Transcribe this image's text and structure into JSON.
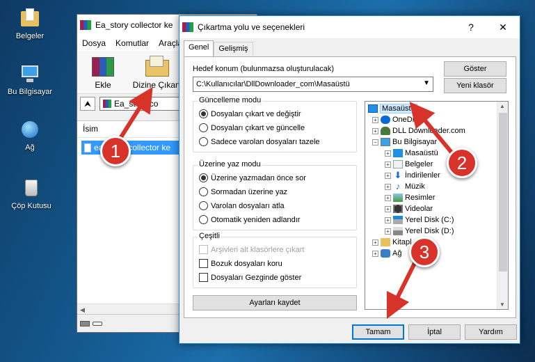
{
  "desktop": {
    "icons": [
      {
        "label": "Belgeler",
        "icon": "folder-documents-icon"
      },
      {
        "label": "Bu Bilgisayar",
        "icon": "computer-icon"
      },
      {
        "label": "Ağ",
        "icon": "network-icon"
      },
      {
        "label": "Çöp Kutusu",
        "icon": "recycle-bin-icon"
      }
    ]
  },
  "winrar": {
    "title": "Ea_story collector ke",
    "menu": [
      "Dosya",
      "Komutlar",
      "Araçla"
    ],
    "toolbar": {
      "add": "Ekle",
      "extract": "Dizine Çıkart"
    },
    "address": "Ea_story co",
    "list_header": "İsim",
    "list_item": "ea_story collector ke"
  },
  "dialog": {
    "title": "Çıkartma yolu ve seçenekleri",
    "help_btn": "?",
    "close_btn": "✕",
    "tabs": [
      "Genel",
      "Gelişmiş"
    ],
    "dest_label": "Hedef konum (bulunmazsa oluşturulacak)",
    "dest_value": "C:\\Kullanıcılar\\DllDownloader_com\\Masaüstü",
    "show_btn": "Göster",
    "new_folder_btn": "Yeni klasör",
    "update_group": {
      "title": "Güncelleme modu",
      "options": [
        "Dosyaları çıkart ve değiştir",
        "Dosyaları çıkart ve güncelle",
        "Sadece varolan dosyaları tazele"
      ],
      "selected": 0
    },
    "overwrite_group": {
      "title": "Üzerine yaz modu",
      "options": [
        "Üzerine yazmadan önce sor",
        "Sormadan üzerine yaz",
        "Varolan dosyaları atla",
        "Otomatik yeniden adlandır"
      ],
      "selected": 0
    },
    "misc_group": {
      "title": "Çeşitli",
      "options": [
        "Arşivleri alt klasörlere çıkart",
        "Bozuk dosyaları koru",
        "Dosyaları Gezginde göster"
      ]
    },
    "save_btn": "Ayarları kaydet",
    "tree": [
      {
        "label": "Masaüstü",
        "icon": "desktop-icon"
      },
      {
        "label": "OneDr",
        "icon": "onedrive-icon"
      },
      {
        "label": "DLL Downloader.com",
        "icon": "user-icon"
      },
      {
        "label": "Bu Bilgisayar",
        "icon": "computer-icon"
      },
      {
        "label": "Masaüstü",
        "icon": "desktop-icon"
      },
      {
        "label": "Belgeler",
        "icon": "documents-icon"
      },
      {
        "label": "İndirilenler",
        "icon": "download-icon"
      },
      {
        "label": "Müzik",
        "icon": "music-icon"
      },
      {
        "label": "Resimler",
        "icon": "pictures-icon"
      },
      {
        "label": "Videolar",
        "icon": "videos-icon"
      },
      {
        "label": "Yerel Disk (C:)",
        "icon": "drive-icon"
      },
      {
        "label": "Yerel Disk (D:)",
        "icon": "drive-icon"
      },
      {
        "label": "Kitapl",
        "icon": "library-icon"
      },
      {
        "label": "Ağ",
        "icon": "network-icon"
      }
    ],
    "ok_btn": "Tamam",
    "cancel_btn": "İptal",
    "help2_btn": "Yardım"
  },
  "annotations": [
    "1",
    "2",
    "3"
  ],
  "colors": {
    "accent": "#0078d7",
    "marker": "#d7332a",
    "selection": "#3399ff"
  }
}
